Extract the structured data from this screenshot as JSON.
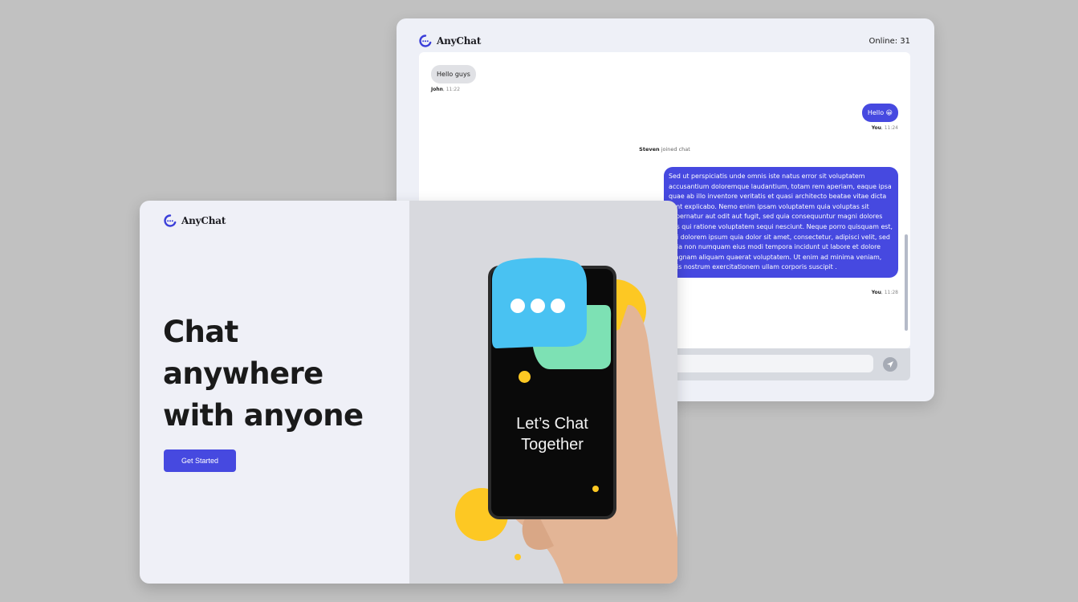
{
  "chat_app": {
    "brand": "AnyChat",
    "online_label": "Online: 31",
    "messages": [
      {
        "text": "Hello guys",
        "author": "John",
        "time": ", 11:22"
      },
      {
        "text": "Hello 😀",
        "author": "You",
        "time": ", 11:24"
      },
      {
        "text": "Sed ut perspiciatis unde omnis iste natus error sit voluptatem accusantium doloremque laudantium, totam rem aperiam, eaque ipsa quae ab illo inventore veritatis et quasi architecto beatae vitae dicta sunt explicabo. Nemo enim ipsam voluptatem quia voluptas sit aspernatur aut odit aut fugit, sed quia consequuntur magni dolores eos qui ratione voluptatem sequi nesciunt. Neque porro quisquam est, qui dolorem ipsum quia dolor sit amet, consectetur, adipisci velit, sed quia non numquam eius modi tempora incidunt ut labore et dolore magnam aliquam quaerat voluptatem. Ut enim ad minima veniam, quis nostrum exercitationem ullam corporis suscipit .",
        "author": "You",
        "time": ", 11:28"
      }
    ],
    "system_event": {
      "name": "Steven",
      "text": " joined chat"
    },
    "input_placeholder": ""
  },
  "landing": {
    "brand": "AnyChat",
    "hero_lines": [
      "Chat",
      "anywhere",
      "with anyone"
    ],
    "cta_label": "Get Started",
    "phone_text": [
      "Let’s Chat",
      "Together"
    ]
  },
  "colors": {
    "accent": "#4649e0",
    "yellow": "#fdc823",
    "bubble_blue": "#49c2f2",
    "bubble_green": "#7de1b4"
  }
}
